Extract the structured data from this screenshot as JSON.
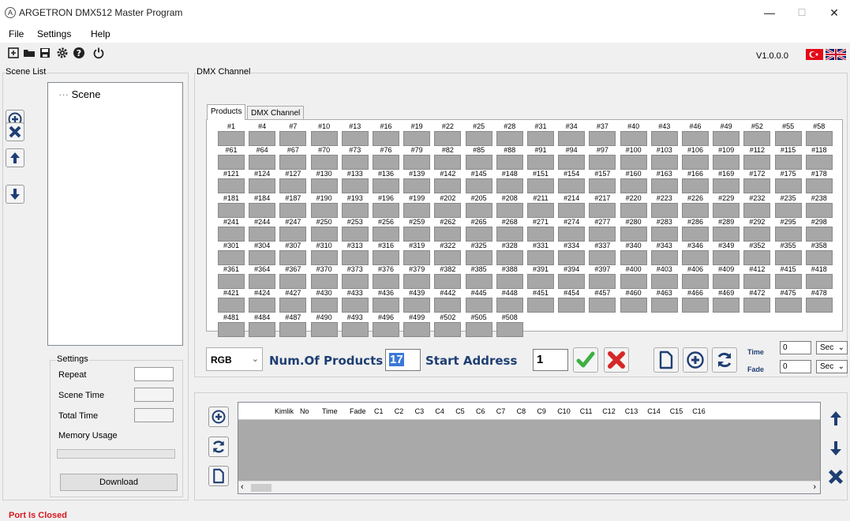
{
  "window": {
    "title": "ARGETRON DMX512 Master Program",
    "app_icon_letter": "A",
    "minimize": "—",
    "maximize": "☐",
    "close": "✕"
  },
  "menu": [
    "File",
    "Settings",
    "Help"
  ],
  "toolbar": {
    "icons": [
      "new-file-icon",
      "open-folder-icon",
      "save-icon",
      "gear-icon",
      "help-icon",
      "power-icon"
    ],
    "version": "V1.0.0.0",
    "flags": [
      "turkey-flag-icon",
      "uk-flag-icon"
    ]
  },
  "scene_list": {
    "title": "Scene List",
    "tree_root": "Scene",
    "buttons": [
      "add-scene-icon",
      "delete-scene-icon",
      "move-up-icon",
      "move-down-icon"
    ]
  },
  "settings": {
    "title": "Settings",
    "repeat_label": "Repeat",
    "scene_time_label": "Scene Time",
    "total_time_label": "Total Time",
    "memory_usage_label": "Memory Usage",
    "repeat_value": "",
    "scene_time_value": "",
    "total_time_value": "",
    "memory_usage_fraction": 0,
    "download_label": "Download"
  },
  "dmx": {
    "group_title": "DMX Channel",
    "tabs": [
      "Products",
      "DMX Channel"
    ],
    "channel_rows": [
      [
        "#1",
        "#4",
        "#7",
        "#10",
        "#13",
        "#16",
        "#19",
        "#22",
        "#25",
        "#28",
        "#31",
        "#34",
        "#37",
        "#40",
        "#43",
        "#46",
        "#49",
        "#52",
        "#55",
        "#58"
      ],
      [
        "#61",
        "#64",
        "#67",
        "#70",
        "#73",
        "#76",
        "#79",
        "#82",
        "#85",
        "#88",
        "#91",
        "#94",
        "#97",
        "#100",
        "#103",
        "#106",
        "#109",
        "#112",
        "#115",
        "#118"
      ],
      [
        "#121",
        "#124",
        "#127",
        "#130",
        "#133",
        "#136",
        "#139",
        "#142",
        "#145",
        "#148",
        "#151",
        "#154",
        "#157",
        "#160",
        "#163",
        "#166",
        "#169",
        "#172",
        "#175",
        "#178"
      ],
      [
        "#181",
        "#184",
        "#187",
        "#190",
        "#193",
        "#196",
        "#199",
        "#202",
        "#205",
        "#208",
        "#211",
        "#214",
        "#217",
        "#220",
        "#223",
        "#226",
        "#229",
        "#232",
        "#235",
        "#238"
      ],
      [
        "#241",
        "#244",
        "#247",
        "#250",
        "#253",
        "#256",
        "#259",
        "#262",
        "#265",
        "#268",
        "#271",
        "#274",
        "#277",
        "#280",
        "#283",
        "#286",
        "#289",
        "#292",
        "#295",
        "#298"
      ],
      [
        "#301",
        "#304",
        "#307",
        "#310",
        "#313",
        "#316",
        "#319",
        "#322",
        "#325",
        "#328",
        "#331",
        "#334",
        "#337",
        "#340",
        "#343",
        "#346",
        "#349",
        "#352",
        "#355",
        "#358"
      ],
      [
        "#361",
        "#364",
        "#367",
        "#370",
        "#373",
        "#376",
        "#379",
        "#382",
        "#385",
        "#388",
        "#391",
        "#394",
        "#397",
        "#400",
        "#403",
        "#406",
        "#409",
        "#412",
        "#415",
        "#418"
      ],
      [
        "#421",
        "#424",
        "#427",
        "#430",
        "#433",
        "#436",
        "#439",
        "#442",
        "#445",
        "#448",
        "#451",
        "#454",
        "#457",
        "#460",
        "#463",
        "#466",
        "#469",
        "#472",
        "#475",
        "#478"
      ],
      [
        "#481",
        "#484",
        "#487",
        "#490",
        "#493",
        "#496",
        "#499",
        "#502",
        "#505",
        "#508"
      ]
    ]
  },
  "controls": {
    "mode_selected": "RGB",
    "num_products_label": "Num.Of Products",
    "num_products_value": "17",
    "start_address_label": "Start Address",
    "start_address_value": "1",
    "time_label": "Time",
    "time_value": "0",
    "time_unit": "Sec",
    "fade_label": "Fade",
    "fade_value": "0",
    "fade_unit": "Sec"
  },
  "grid": {
    "columns": [
      "Kimlik",
      "No",
      "Time",
      "Fade",
      "C1",
      "C2",
      "C3",
      "C4",
      "C5",
      "C6",
      "C7",
      "C8",
      "C9",
      "C10",
      "C11",
      "C12",
      "C13",
      "C14",
      "C15",
      "C16"
    ]
  },
  "status": "Port Is Closed",
  "colors": {
    "accent_blue": "#1f3f73",
    "status_red": "#d71920",
    "check_green": "#3cb043",
    "x_red": "#d62828"
  }
}
